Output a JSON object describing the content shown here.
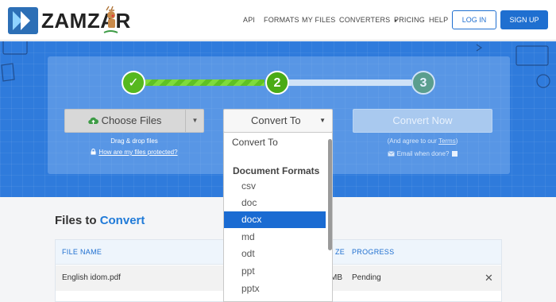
{
  "brand": {
    "name": "ZAMZAR"
  },
  "nav": {
    "items": [
      "API",
      "FORMATS",
      "MY FILES",
      "CONVERTERS",
      "PRICING",
      "HELP"
    ],
    "login": "LOG IN",
    "signup": "SIGN UP"
  },
  "steps": {
    "one": "✓",
    "two": "2",
    "three": "3"
  },
  "upload": {
    "choose_label": "Choose Files",
    "drag_text": "Drag & drop files",
    "protect_link": "How are my files protected?"
  },
  "convert": {
    "select_value": "Convert To",
    "now_label": "Convert Now",
    "agree_prefix": "(And agree to our ",
    "agree_link": "Terms",
    "agree_suffix": ")",
    "email_label": "Email when done?"
  },
  "dropdown": {
    "placeholder": "Convert To",
    "group": "Document Formats",
    "options": [
      "csv",
      "doc",
      "docx",
      "md",
      "odt",
      "ppt",
      "pptx"
    ],
    "selected": "docx"
  },
  "files": {
    "title_prefix": "Files to",
    "title_accent": "Convert",
    "columns": {
      "name": "FILE NAME",
      "size": "ZE",
      "progress": "PROGRESS"
    },
    "rows": [
      {
        "name": "English idom.pdf",
        "size": "MB",
        "progress": "Pending"
      }
    ]
  },
  "colors": {
    "accent": "#1f6fd0",
    "hero": "#2f7bdc",
    "step_done": "#56b81f",
    "selected": "#1a6bd2"
  }
}
